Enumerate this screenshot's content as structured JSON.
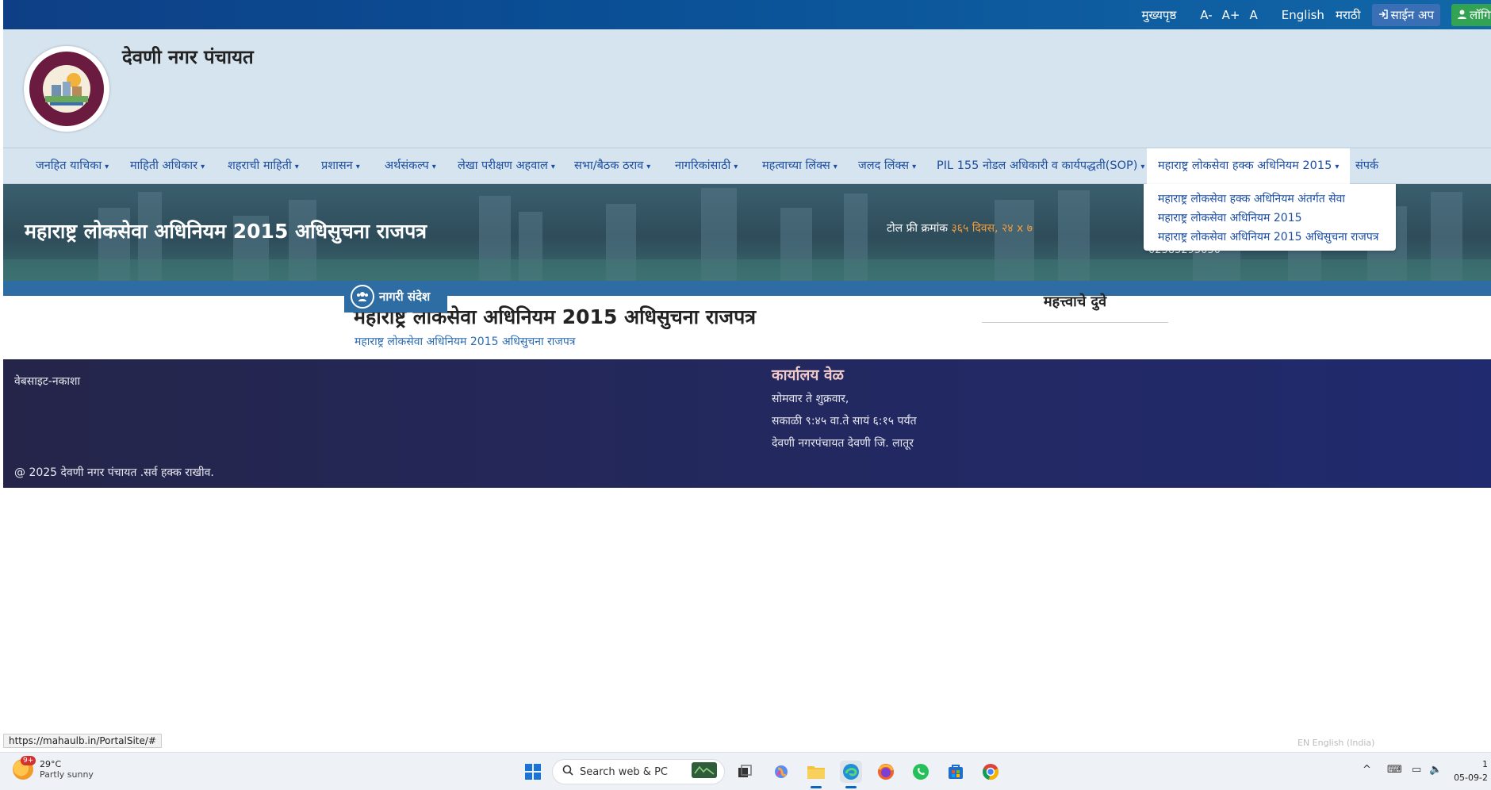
{
  "topbar": {
    "home": "मुख्यपृष्ठ",
    "font_small": "A-",
    "font_large": "A+",
    "font_normal": "A",
    "lang_en": "English",
    "lang_mr": "मराठी",
    "signup": "साईन अप",
    "login": "लॉगिन"
  },
  "header": {
    "site_title": "देवणी नगर पंचायत"
  },
  "nav": {
    "items": [
      {
        "label": "जनहित याचिका"
      },
      {
        "label": "माहिती अधिकार"
      },
      {
        "label": "शहराची माहिती"
      },
      {
        "label": "प्रशासन"
      },
      {
        "label": "अर्थसंकल्प"
      },
      {
        "label": "लेखा परीक्षण अहवाल"
      },
      {
        "label": "सभा/बैठक ठराव"
      },
      {
        "label": "नागरिकांसाठी"
      },
      {
        "label": "महत्वाच्या लिंक्स"
      },
      {
        "label": "जलद लिंक्स"
      },
      {
        "label": "PIL 155 नोडल अधिकारी व कार्यपद्धती(SOP)"
      },
      {
        "label": "महाराष्ट्र लोकसेवा हक्क अधिनियम 2015"
      },
      {
        "label": "संपर्क"
      }
    ],
    "dropdown": [
      "महाराष्ट्र लोकसेवा हक्क अधिनियम अंतर्गत सेवा",
      "महाराष्ट्र लोकसेवा अधिनियम 2015",
      "महाराष्ट्र लोकसेवा अधिनियम 2015 अधिसुचना राजपत्र"
    ]
  },
  "banner": {
    "title": "महाराष्ट्र लोकसेवा अधिनियम 2015 अधिसुचना राजपत्र",
    "tollfree_label": "टोल फ्री क्रमांक",
    "tollfree_hours": "३६५ दिवस, २४ x ७",
    "phone": "02385295050"
  },
  "content": {
    "notice_badge": "नागरी संदेश",
    "title": "महाराष्ट्र लोकसेवा अधिनियम 2015 अधिसुचना राजपत्र",
    "breadcrumb": "महाराष्ट्र लोकसेवा अधिनियम 2015 अधिसुचना राजपत्र",
    "important_links": "महत्त्वाचे दुवे"
  },
  "footer": {
    "sitemap": "वेबसाइट-नकाशा",
    "office_heading": "कार्यालय वेळ",
    "office_days": "सोमवार ते शुक्रवार,",
    "office_hours": "सकाळी ९:४५ वा.ते सायं ६:१५ पर्यंत",
    "office_address": "देवणी नगरपंचायत देवणी जि. लातूर",
    "copyright": "@ 2025 देवणी नगर पंचायत .सर्व हक्क राखीव."
  },
  "status": {
    "url": "https://mahaulb.in/PortalSite/#",
    "lang_indicator": "EN English (India)"
  },
  "taskbar": {
    "weather_temp": "29°C",
    "weather_desc": "Partly sunny",
    "weather_badge": "9+",
    "search_placeholder": "Search web & PC",
    "time": "1",
    "date": "05-09-2"
  }
}
